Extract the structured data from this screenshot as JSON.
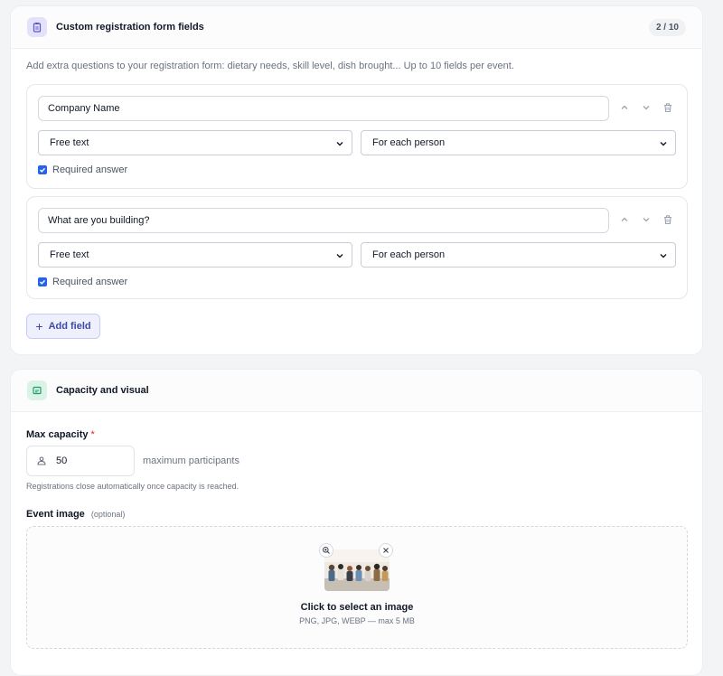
{
  "colors": {
    "accent": "#2563eb",
    "add_button_text": "#3f4aa6",
    "required_star": "#dc2626"
  },
  "registration": {
    "title": "Custom registration form fields",
    "icon": "clipboard-icon",
    "counter": "2 / 10",
    "description": "Add extra questions to your registration form: dietary needs, skill level, dish brought... Up to 10 fields per event.",
    "fields": [
      {
        "question": "Company Name",
        "type": "Free text",
        "scope": "For each person",
        "required_label": "Required answer",
        "required": true
      },
      {
        "question": "What are you building?",
        "type": "Free text",
        "scope": "For each person",
        "required_label": "Required answer",
        "required": true
      }
    ],
    "add_label": "Add field"
  },
  "capacity": {
    "title": "Capacity and visual",
    "icon": "image-frame-icon",
    "label": "Max capacity",
    "required_mark": "*",
    "value": "50",
    "suffix": "maximum participants",
    "hint": "Registrations close automatically once capacity is reached.",
    "image_label": "Event image",
    "image_optional": "(optional)",
    "dropzone_title": "Click to select an image",
    "dropzone_sub": "PNG, JPG, WEBP — max 5 MB"
  }
}
